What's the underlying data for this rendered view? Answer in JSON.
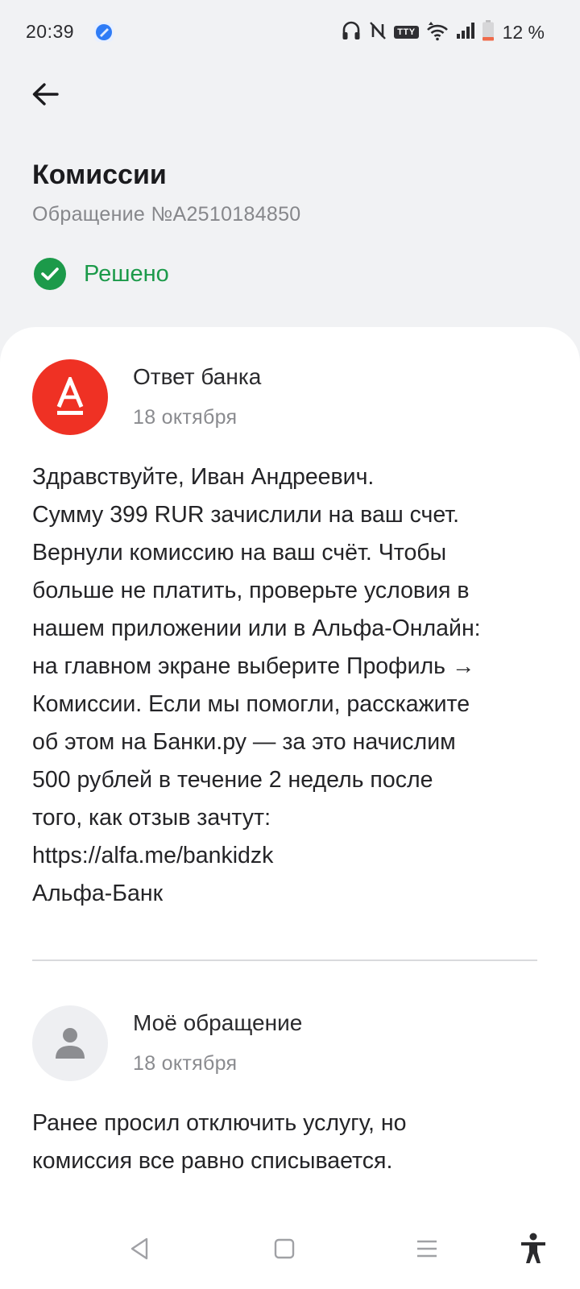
{
  "status_bar": {
    "time": "20:39",
    "tty_label": "TTY",
    "battery": "12 %",
    "icons": [
      "app-icon",
      "headphones-icon",
      "nfc-off-icon",
      "tty-icon",
      "wifi-icon",
      "signal-icon",
      "battery-icon"
    ]
  },
  "header": {
    "title": "Комиссии",
    "subtitle": "Обращение №A2510184850",
    "status": "Решено",
    "status_color": "#1c9a4a"
  },
  "messages": [
    {
      "author": "Ответ банка",
      "date": "18 октября",
      "avatar_letter": "А",
      "avatar_color": "#ef3124",
      "lines": [
        "Здравствуйте, Иван Андреевич.",
        "Сумму 399 RUR зачислили на ваш счет.",
        "Вернули комиссию на ваш счёт. Чтобы",
        "больше не платить, проверьте условия в",
        "нашем приложении или в Альфа-Онлайн:",
        "на главном экране выберите Профиль →",
        "Комиссии. Если мы помогли, расскажите",
        "об этом на Банки.ру — за это начислим",
        "500 рублей в течение 2 недель после",
        "того, как отзыв зачтут:",
        "https://alfa.me/bankidzk",
        "Альфа-Банк"
      ]
    },
    {
      "author": "Моё обращение",
      "date": "18 октября",
      "lines": [
        "Ранее просил отключить услугу, но",
        "комиссия все равно списывается."
      ]
    }
  ],
  "nav_bar": {
    "icons": [
      "back-triangle-icon",
      "home-square-icon",
      "menu-lines-icon",
      "accessibility-icon"
    ]
  }
}
